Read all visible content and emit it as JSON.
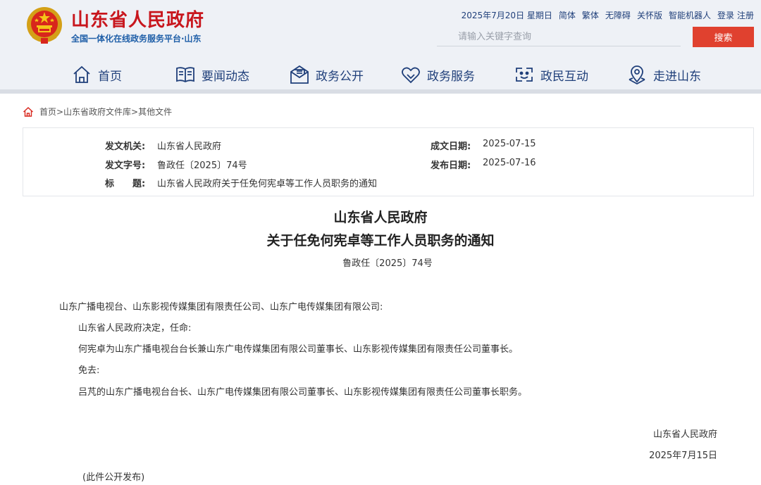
{
  "header": {
    "site_title": "山东省人民政府",
    "site_subtitle": "全国一体化在线政务服务平台·山东",
    "top_links": {
      "date": "2025年7月20日 星期日",
      "simplified": "简体",
      "traditional": "繁体",
      "accessibility": "无障碍",
      "elderly": "关怀版",
      "robot": "智能机器人",
      "login": "登录",
      "register": "注册"
    },
    "search": {
      "placeholder": "请输入关键字查询",
      "button_label": "搜索"
    },
    "nav": [
      {
        "label": "首页",
        "icon": "home-icon"
      },
      {
        "label": "要闻动态",
        "icon": "book-icon"
      },
      {
        "label": "政务公开",
        "icon": "mail-icon"
      },
      {
        "label": "政务服务",
        "icon": "heart-icon"
      },
      {
        "label": "政民互动",
        "icon": "interaction-icon"
      },
      {
        "label": "走进山东",
        "icon": "location-icon"
      }
    ]
  },
  "breadcrumb": {
    "text": "首页>山东省政府文件库>其他文件"
  },
  "meta": {
    "issuer_label": "发文机关:",
    "issuer_value": "山东省人民政府",
    "doc_no_label": "发文字号:",
    "doc_no_value": "鲁政任〔2025〕74号",
    "title_label": "标　　题:",
    "title_value": "山东省人民政府关于任免何宪卓等工作人员职务的通知",
    "created_label": "成文日期:",
    "created_value": "2025-07-15",
    "published_label": "发布日期:",
    "published_value": "2025-07-16"
  },
  "document": {
    "title_line1": "山东省人民政府",
    "title_line2": "关于任免何宪卓等工作人员职务的通知",
    "number": "鲁政任〔2025〕74号",
    "recipients": "山东广播电视台、山东影视传媒集团有限责任公司、山东广电传媒集团有限公司:",
    "para1": "山东省人民政府决定，任命:",
    "para2": "何宪卓为山东广播电视台台长兼山东广电传媒集团有限公司董事长、山东影视传媒集团有限责任公司董事长。",
    "para3": "免去:",
    "para4": "吕芃的山东广播电视台台长、山东广电传媒集团有限公司董事长、山东影视传媒集团有限责任公司董事长职务。",
    "signature": "山东省人民政府",
    "date": "2025年7月15日",
    "note": "(此件公开发布)"
  },
  "colors": {
    "title_red": "#c8161d",
    "nav_blue": "#1f3f7a",
    "search_red": "#e0412f",
    "header_bg": "#eef1f6"
  }
}
